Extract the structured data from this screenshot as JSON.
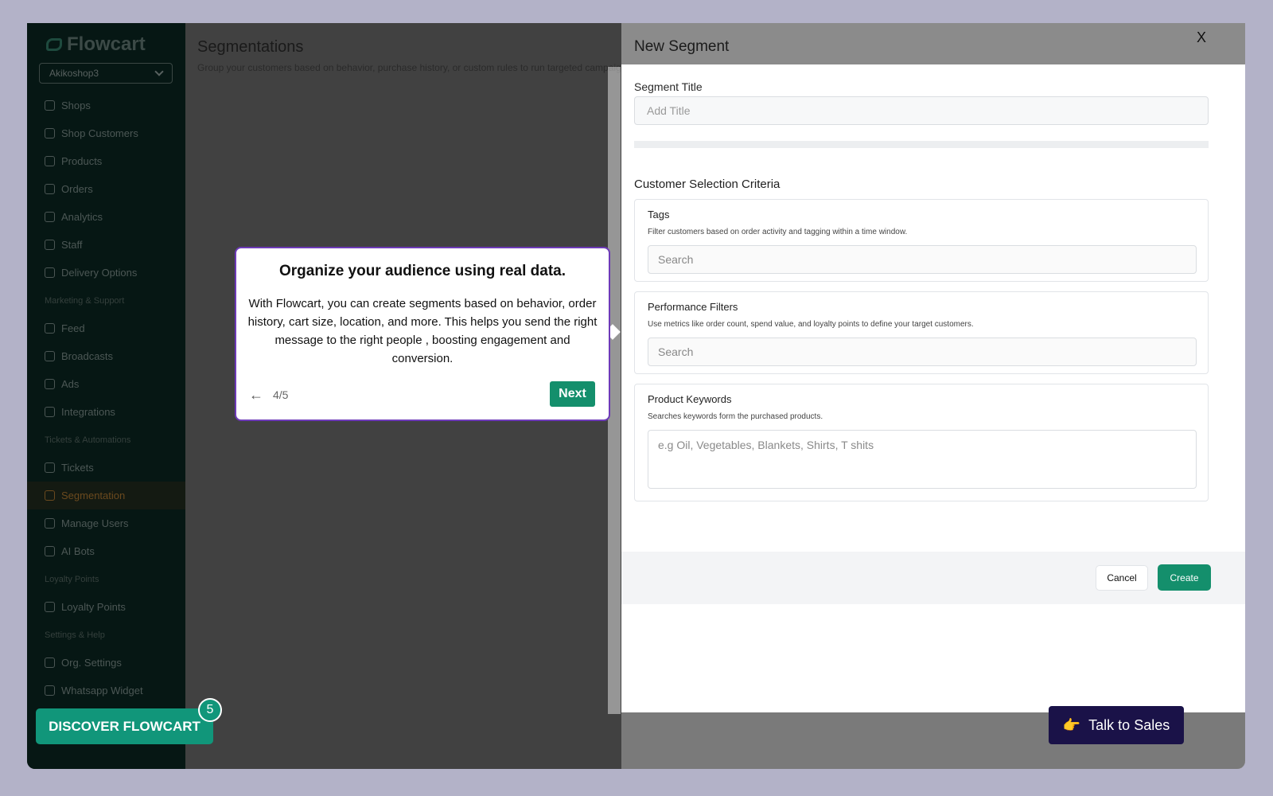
{
  "app": {
    "name": "Flowcart",
    "shop": "Akikoshop3"
  },
  "sidebar": {
    "items": [
      {
        "type": "item",
        "label": "Shops",
        "icon": "store-icon"
      },
      {
        "type": "item",
        "label": "Shop Customers",
        "icon": "users-icon"
      },
      {
        "type": "item",
        "label": "Products",
        "icon": "box-icon"
      },
      {
        "type": "item",
        "label": "Orders",
        "icon": "package-icon"
      },
      {
        "type": "item",
        "label": "Analytics",
        "icon": "chart-icon"
      },
      {
        "type": "item",
        "label": "Staff",
        "icon": "user-icon"
      },
      {
        "type": "item",
        "label": "Delivery Options",
        "icon": "truck-icon"
      },
      {
        "type": "section",
        "label": "Marketing & Support"
      },
      {
        "type": "item",
        "label": "Feed",
        "icon": "feed-icon"
      },
      {
        "type": "item",
        "label": "Broadcasts",
        "icon": "megaphone-icon"
      },
      {
        "type": "item",
        "label": "Ads",
        "icon": "sparkle-icon"
      },
      {
        "type": "item",
        "label": "Integrations",
        "icon": "grid-icon"
      },
      {
        "type": "section",
        "label": "Tickets & Automations"
      },
      {
        "type": "item",
        "label": "Tickets",
        "icon": "ticket-icon"
      },
      {
        "type": "item",
        "label": "Segmentation",
        "icon": "segment-icon",
        "active": true
      },
      {
        "type": "item",
        "label": "Manage Users",
        "icon": "user-cog-icon"
      },
      {
        "type": "item",
        "label": "AI Bots",
        "icon": "bot-icon"
      },
      {
        "type": "section",
        "label": "Loyalty Points"
      },
      {
        "type": "item",
        "label": "Loyalty Points",
        "icon": "scan-icon"
      },
      {
        "type": "section",
        "label": "Settings & Help"
      },
      {
        "type": "item",
        "label": "Org. Settings",
        "icon": "gear-icon"
      },
      {
        "type": "item",
        "label": "Whatsapp Widget",
        "icon": "chat-icon"
      }
    ]
  },
  "main": {
    "title": "Segmentations",
    "subtitle": "Group your customers based on behavior, purchase history, or custom rules to run targeted campaig"
  },
  "drawer": {
    "title": "New Segment",
    "close_label": "X",
    "segment_title_label": "Segment Title",
    "segment_title_placeholder": "Add Title",
    "criteria_heading": "Customer Selection Criteria",
    "cards": [
      {
        "title": "Tags",
        "desc": "Filter customers based on order activity and tagging within a time window.",
        "placeholder": "Search"
      },
      {
        "title": "Performance Filters",
        "desc": "Use metrics like order count, spend value, and loyalty points to define your target customers.",
        "placeholder": "Search"
      },
      {
        "title": "Product Keywords",
        "desc": "Searches keywords form the purchased products.",
        "placeholder": "e.g Oil, Vegetables, Blankets, Shirts, T shits"
      }
    ],
    "cancel_label": "Cancel",
    "create_label": "Create"
  },
  "tooltip": {
    "title": "Organize your audience using real data.",
    "body": "With Flowcart, you can create segments based on behavior, order history, cart size, location, and more. This helps you send the right message to the right people , boosting engagement and conversion.",
    "back_glyph": "←",
    "step": "4/5",
    "next_label": "Next"
  },
  "discover": {
    "label": "DISCOVER FLOWCART",
    "badge": "5"
  },
  "talk_to_sales": {
    "label": "Talk to Sales",
    "icon": "pointing-hand-icon"
  },
  "colors": {
    "accent": "#148f6c",
    "tooltip_border": "#6d3ab8",
    "sales_bg": "#1a1248"
  }
}
